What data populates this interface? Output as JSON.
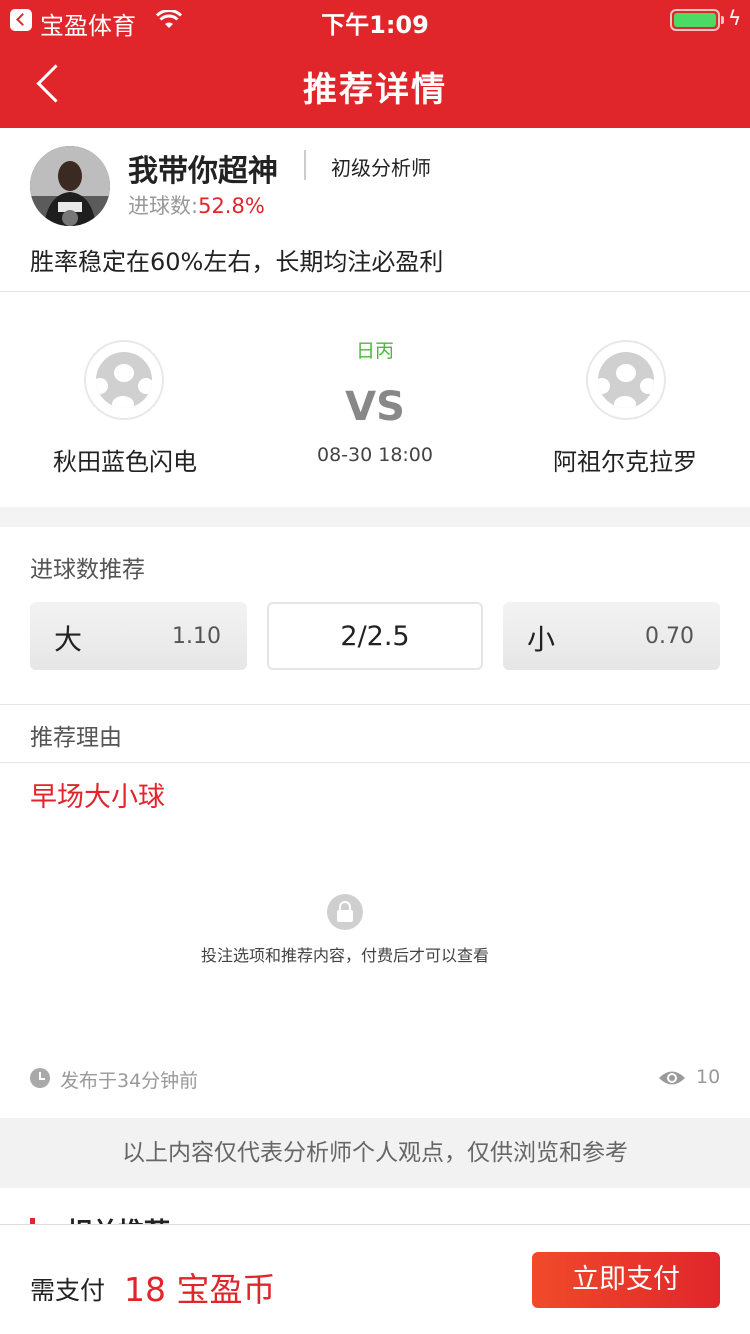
{
  "status_bar": {
    "app_name": "宝盈体育",
    "time": "下午1:09",
    "icons": [
      "back-app-icon",
      "wifi-icon",
      "battery-icon",
      "charging-icon"
    ]
  },
  "nav": {
    "title": "推荐详情",
    "back_icon": "chevron-left-icon"
  },
  "analyst": {
    "name": "我带你超神",
    "level": "初级分析师",
    "stat_label": "进球数:",
    "stat_value": "52.8%",
    "motto": "胜率稳定在60%左右，长期均注必盈利"
  },
  "match": {
    "league": "日丙",
    "vs": "VS",
    "time": "08-30 18:00",
    "home_team": "秋田蓝色闪电",
    "away_team": "阿祖尔克拉罗"
  },
  "recommendation": {
    "title": "进球数推荐",
    "options": {
      "big_label": "大",
      "big_odds": "1.10",
      "line": "2/2.5",
      "small_label": "小",
      "small_odds": "0.70"
    }
  },
  "reason": {
    "title": "推荐理由",
    "text": "早场大小球",
    "locked_text": "投注选项和推荐内容，付费后才可以查看",
    "published": "发布于34分钟前",
    "views": "10"
  },
  "disclaimer": "以上内容仅代表分析师个人观点，仅供浏览和参考",
  "related": {
    "title": "相关推荐"
  },
  "pay": {
    "label": "需支付",
    "amount": "18 宝盈币",
    "button": "立即支付"
  },
  "colors": {
    "brand_red": "#e0262b",
    "league_green": "#4cb83c"
  }
}
